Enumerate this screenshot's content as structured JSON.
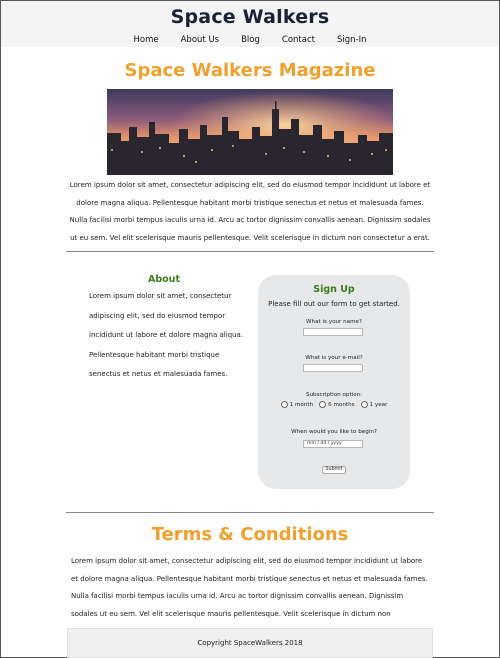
{
  "header": {
    "site_title": "Space Walkers",
    "nav": [
      "Home",
      "About Us",
      "Blog",
      "Contact",
      "Sign-In"
    ]
  },
  "magazine": {
    "title": "Space Walkers Magazine",
    "image": "city-skyline-sunset",
    "text": "Lorem ipsum dolor sit amet, consectetur adipiscing elit, sed do eiusmod tempor incididunt ut labore et dolore magna aliqua. Pellentesque habitant morbi tristique senectus et netus et malesuada fames. Nulla facilisi morbi tempus iaculis urna id. Arcu ac tortor dignissim convallis aenean. Dignissim sodales ut eu sem. Vel elit scelerisque mauris pellentesque. Velit scelerisque in dictum non consectetur a erat."
  },
  "about": {
    "title": "About",
    "text": "Lorem ipsum dolor sit amet, consectetur adipiscing elit, sed do eiusmod tempor incididunt ut labore et dolore magna aliqua. Pellentesque habitant morbi tristique senectus et netus et malesuada fames."
  },
  "signup": {
    "title": "Sign Up",
    "intro": "Please fill out our form to get started.",
    "name_label": "What is your name?",
    "email_label": "What is your e-mail?",
    "subscription_label": "Subscription option:",
    "options": [
      "1 month",
      "6 months",
      "1 year"
    ],
    "begin_label": "When would you like to begin?",
    "date_placeholder": "mm / dd / yyyy",
    "submit_label": "Submit"
  },
  "terms": {
    "title": "Terms & Conditions",
    "text": "Lorem ipsum dolor sit amet, consectetur adipiscing elit, sed do eiusmod tempor incididunt ut labore et dolore magna aliqua. Pellentesque habitant morbi tristique senectus et netus et malesuada fames. Nulla facilisi morbi tempus iaculis urna id. Arcu ac tortor dignissim convallis aenean. Dignissim sodales ut eu sem. Vel elit scelerisque mauris pellentesque. Velit scelerisque in dictum non consectetur a erat."
  },
  "footer": {
    "text": "Copyright SpaceWalkers 2018"
  },
  "colors": {
    "accent_orange": "#f0a02c",
    "heading_green": "#3a7d1a",
    "title_navy": "#1b2135"
  }
}
